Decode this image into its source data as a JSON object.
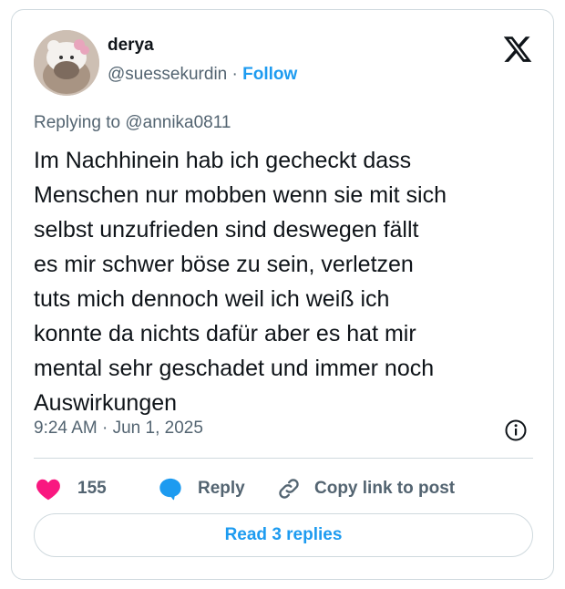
{
  "author": {
    "name": "derya",
    "handle": "@suessekurdin",
    "separator": "·",
    "follow_label": "Follow"
  },
  "brand": {
    "icon": "x-logo-icon"
  },
  "reply_context": {
    "text": "Replying to @annika0811"
  },
  "post": {
    "text": "Im Nachhinein hab ich gecheckt dass\nMenschen nur mobben wenn sie mit sich\nselbst unzufrieden sind deswegen fällt\nes mir schwer böse zu sein, verletzen\ntuts mich dennoch weil ich weiß ich\nkonnte da nichts dafür aber es hat mir\nmental sehr geschadet und immer noch\nAuswirkungen",
    "timestamp": "9:24 AM · Jun 1, 2025"
  },
  "actions": {
    "like_count": "155",
    "reply_label": "Reply",
    "copy_label": "Copy link to post"
  },
  "read_replies": {
    "label": "Read 3 replies"
  },
  "colors": {
    "accent": "#1d9bf0",
    "like": "#f91880",
    "muted": "#536471",
    "border": "#cfd9de"
  }
}
